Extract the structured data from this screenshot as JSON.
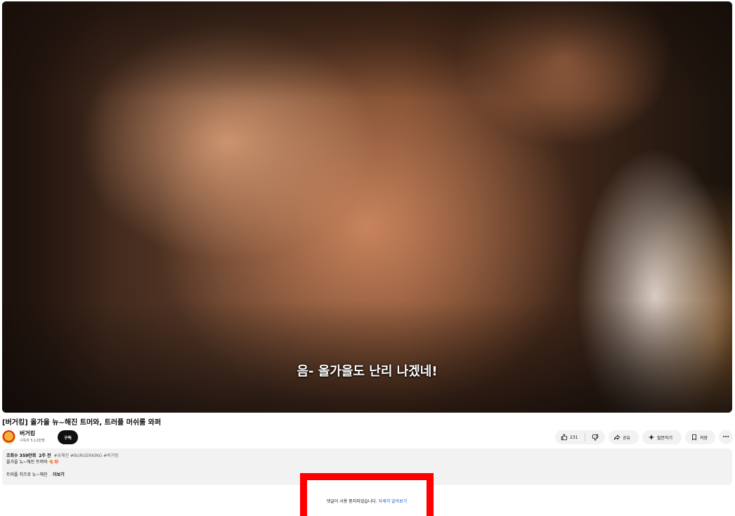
{
  "player": {
    "subtitle": "음- 올가을도 난리 나겠네!"
  },
  "video": {
    "title": "[버거킹] 올가을 뉴~해진 트머와, 트러플 머쉬룸 와퍼"
  },
  "channel": {
    "name": "버거킹",
    "subscribers": "구독자 5.12만명",
    "subscribe_label": "구독"
  },
  "actions": {
    "like_count": "231",
    "share_label": "공유",
    "clip_label": "질문하기",
    "save_label": "저장",
    "more_label": "⋯"
  },
  "description": {
    "views": "조회수 359만회",
    "age": "2주 전",
    "hashtags": "#유해진 #BURGERKING #버거킹",
    "line1": "올가을 뉴~해진 트머와 🍕🍄",
    "snippet": "트러플 치즈로 뉴~해진",
    "snippet_fade": "...",
    "more_label": "더보기"
  },
  "comments": {
    "disabled_text": "댓글이 사용 중지되었습니다.",
    "learn_more": "자세히 알아보기"
  },
  "colors": {
    "highlight": "#ff0000",
    "link": "#065fd4",
    "subscribe_bg": "#0f0f0f",
    "pill_bg": "#f2f2f2"
  },
  "icons": [
    "thumbs-up-icon",
    "thumbs-down-icon",
    "share-icon",
    "sparkle-icon",
    "bookmark-icon",
    "more-icon"
  ]
}
